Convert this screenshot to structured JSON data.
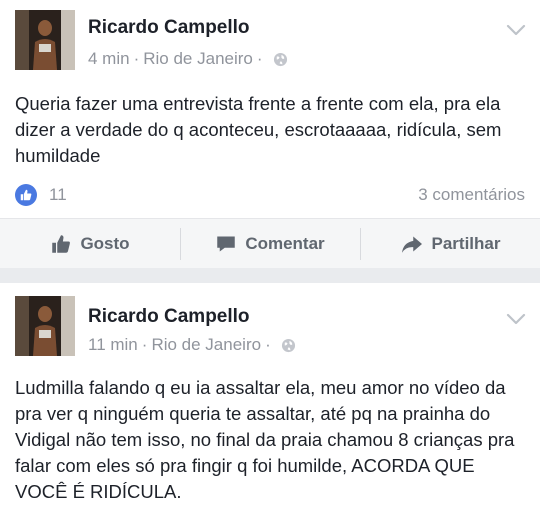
{
  "posts": [
    {
      "author": "Ricardo Campello",
      "time": "4 min",
      "location": "Rio de Janeiro",
      "separator": "·",
      "text": "Queria fazer uma entrevista frente a frente com ela, pra ela dizer a verdade do q aconteceu, escrotaaaaa, ridícula, sem humildade",
      "likes": "11",
      "comments": "3 comentários",
      "actions": {
        "like": "Gosto",
        "comment": "Comentar",
        "share": "Partilhar"
      }
    },
    {
      "author": "Ricardo Campello",
      "time": "11 min",
      "location": "Rio de Janeiro",
      "separator": "·",
      "text": "Ludmilla falando q eu ia assaltar ela, meu amor no vídeo da pra ver q ninguém queria te assaltar, até pq na prainha do Vidigal não tem isso, no final da praia chamou 8 crianças pra falar com eles só pra fingir q foi humilde, ACORDA QUE VOCÊ É RIDÍCULA."
    }
  ],
  "colors": {
    "like_blue": "#4a79e1",
    "meta_gray": "#90949c",
    "action_gray": "#606770",
    "feed_background": "#e9ebee"
  },
  "icons": {
    "privacy": "globe-icon",
    "menu": "chevron-down-icon",
    "like": "thumbs-up-icon",
    "comment": "speech-bubble-icon",
    "share": "share-arrow-icon"
  }
}
